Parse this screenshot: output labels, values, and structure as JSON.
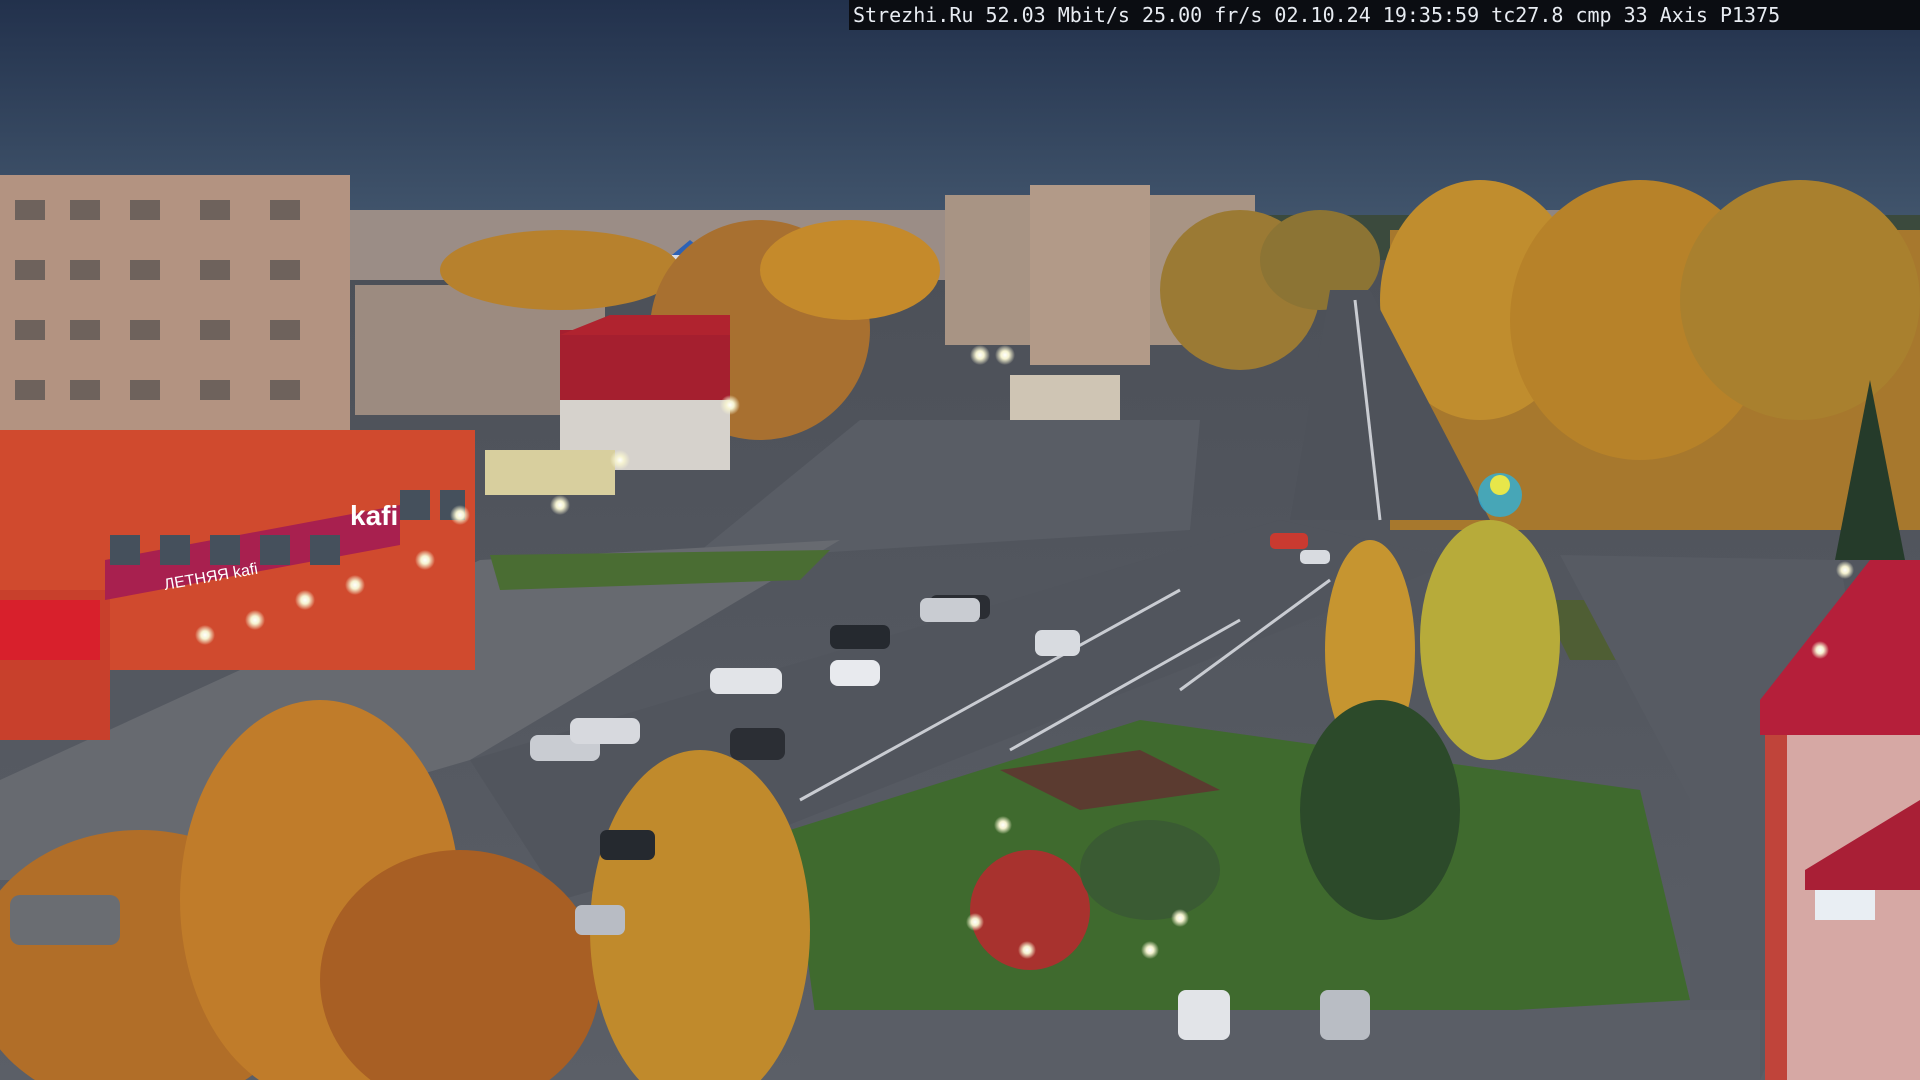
{
  "overlay": {
    "text": "Strezhi.Ru 52.03 Mbit/s 25.00 fr/s 02.10.24 19:35:59  tc27.8  cmp 33   Axis P1375"
  },
  "signs": {
    "kafi_top": "kafi",
    "kafi_strip": "ЛЕТНЯЯ kafi"
  },
  "colors": {
    "sky_top": "#243552",
    "sky_bottom": "#3f5470",
    "foliage": "#c98a2a",
    "brick": "#b08a72",
    "asphalt": "#5c6068",
    "grass": "#3f6a2e",
    "shop_red": "#d24a2e",
    "sign_magenta": "#a8204f",
    "roof_red": "#b0232f"
  }
}
